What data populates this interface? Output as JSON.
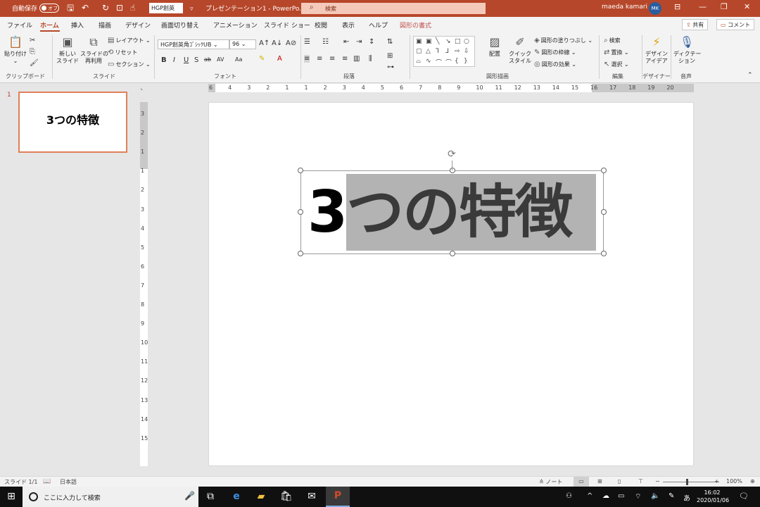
{
  "titlebar": {
    "autosave_label": "自動保存",
    "autosave_state": "オフ",
    "quick_font": "HGP創英",
    "doc_title": "プレゼンテーション1 - PowerPo...",
    "search_placeholder": "検索",
    "user_name": "maeda kamari",
    "user_initials": "MK",
    "accent": "#b7472a"
  },
  "tabs": [
    "ファイル",
    "ホーム",
    "挿入",
    "描画",
    "デザイン",
    "画面切り替え",
    "アニメーション",
    "スライド ショー",
    "校閲",
    "表示",
    "ヘルプ",
    "図形の書式"
  ],
  "share_label": "共有",
  "comment_label": "コメント",
  "ribbon": {
    "clipboard": {
      "paste": "貼り付け",
      "group": "クリップボード"
    },
    "slides": {
      "new_slide": "新しい\nスライド",
      "reuse": "スライドの\n再利用",
      "layout": "レイアウト",
      "reset": "リセット",
      "section": "セクション",
      "group": "スライド"
    },
    "font": {
      "family": "HGP創英角ｺﾞｼｯｸUB",
      "size": "96",
      "bold": "B",
      "italic": "I",
      "underline": "U",
      "shadow": "S",
      "strike": "ab",
      "spacing": "AV",
      "case": "Aa",
      "group": "フォント"
    },
    "paragraph": {
      "group": "段落"
    },
    "drawing": {
      "arrange": "配置",
      "quick_style": "クイック\nスタイル",
      "fill": "図形の塗りつぶし",
      "outline": "図形の枠線",
      "effect": "図形の効果",
      "group": "図形描画"
    },
    "editing": {
      "find": "検索",
      "replace": "置換",
      "select": "選択",
      "group": "編集"
    },
    "designer": {
      "idea": "デザイン\nアイデア",
      "group": "デザイナー"
    },
    "voice": {
      "dictate": "ディクテー\nション",
      "group": "音声"
    }
  },
  "thumbnail": {
    "number": "1",
    "title": "3つの特徴"
  },
  "slide": {
    "title_first": "3",
    "title_rest": "つの特徴"
  },
  "hruler_labels": [
    "6",
    "4",
    "3",
    "2",
    "1",
    "1",
    "2",
    "3",
    "4",
    "5",
    "6",
    "7",
    "8",
    "9",
    "10",
    "11",
    "12",
    "13",
    "14",
    "15",
    "16",
    "17",
    "18",
    "19",
    "20"
  ],
  "vruler_labels": [
    "3",
    "2",
    "1",
    "1",
    "2",
    "3",
    "4",
    "5",
    "6",
    "7",
    "8",
    "9",
    "10",
    "11",
    "12",
    "13",
    "14",
    "15"
  ],
  "status": {
    "slide": "スライド 1/1",
    "language": "日本語",
    "notes": "ノート",
    "zoom": "100%"
  },
  "taskbar": {
    "search": "ここに入力して検索",
    "time": "16:02",
    "date": "2020/01/06",
    "ime": "あ"
  }
}
